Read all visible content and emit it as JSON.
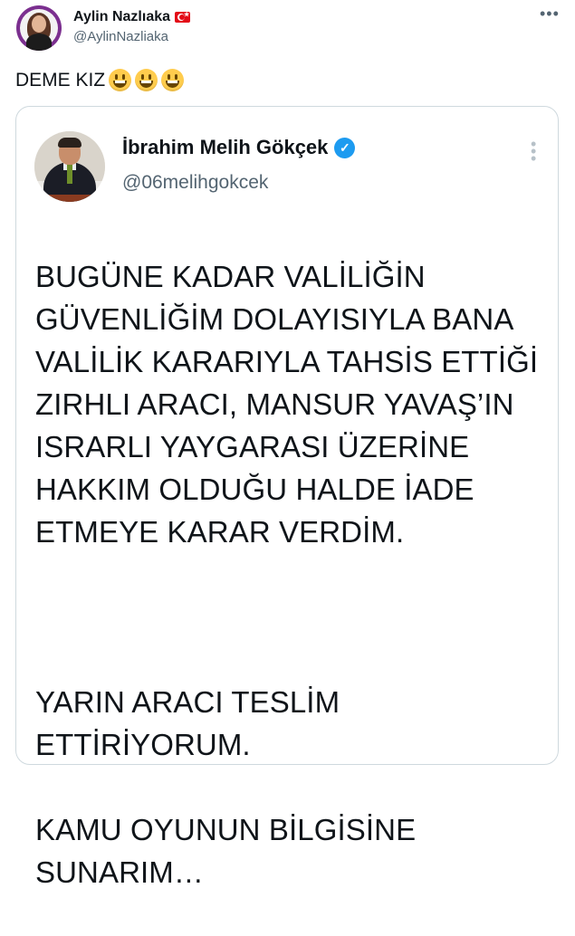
{
  "tweet": {
    "author": {
      "name": "Aylin Nazlıaka",
      "handle": "@AylinNazliaka",
      "badge_icon": "turkey-flag-icon"
    },
    "text": "DEME KIZ",
    "emojis": [
      "grinning-face-icon",
      "grinning-face-icon",
      "grinning-face-icon"
    ],
    "more_icon": "more-options-icon"
  },
  "quoted_tweet": {
    "author": {
      "name": "İbrahim Melih Gökçek",
      "handle": "@06melihgokcek",
      "verified_icon": "verified-badge-icon",
      "verified_color": "#1d9bf0"
    },
    "paragraphs": [
      "BUGÜNE KADAR VALİLİĞİN GÜVENLİĞİM DOLAYISIYLA BANA VALİLİK KARARIYLA TAHSİS ETTİĞİ ZIRHLI ARACI, MANSUR YAVAŞ’IN ISRARLI YAYGARASI ÜZERİNE  HAKKIM OLDUĞU HALDE İADE ETMEYE KARAR VERDİM.",
      "YARIN ARACI TESLİM ETTİRİYORUM.",
      "KAMU OYUNUN BİLGİSİNE SUNARIM…"
    ],
    "more_icon": "more-options-icon"
  }
}
